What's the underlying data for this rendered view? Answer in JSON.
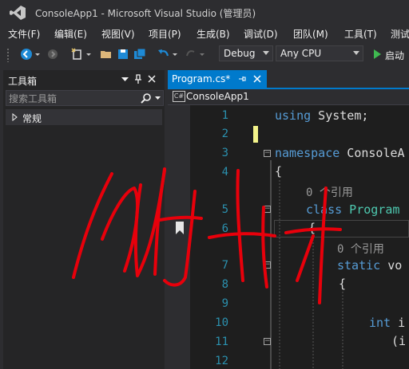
{
  "window": {
    "title": "ConsoleApp1 - Microsoft Visual Studio (管理员)"
  },
  "menu": [
    "文件(F)",
    "编辑(E)",
    "视图(V)",
    "项目(P)",
    "生成(B)",
    "调试(D)",
    "团队(M)",
    "工具(T)",
    "测试"
  ],
  "toolbar": {
    "config": "Debug",
    "platform": "Any CPU",
    "start_label": "启动",
    "icons": [
      "back-icon",
      "forward-icon",
      "new-project-icon",
      "open-icon",
      "save-icon",
      "save-all-icon",
      "undo-icon",
      "redo-icon",
      "start-icon"
    ]
  },
  "toolbox": {
    "title": "工具箱",
    "search_placeholder": "搜索工具箱",
    "group": "常规"
  },
  "editor": {
    "tab": "Program.cs*",
    "navigation": "ConsoleApp1",
    "nav_icon_text": "C#",
    "line_numbers": [
      "1",
      "2",
      "3",
      "4",
      "5",
      "6",
      "7",
      "8",
      "9",
      "10",
      "11",
      "12"
    ],
    "code": {
      "l1_kw": "using",
      "l1_rest": " System;",
      "l3_kw": "namespace",
      "l3_rest": " ConsoleA",
      "l4": "{",
      "ref1": "0 个引用",
      "l5_kw": "class",
      "l5_rest": " Program",
      "l6": "{",
      "ref2": "0 个引用",
      "l7_kw": "static",
      "l7_rest": " vo",
      "l8": "{",
      "l10_kw": "int",
      "l10_rest": " i",
      "l11": "(i"
    }
  },
  "colors": {
    "accent": "#007acc",
    "keyword": "#569cd6",
    "line_number": "#2b91af",
    "annotation_ink": "#e8000b"
  }
}
